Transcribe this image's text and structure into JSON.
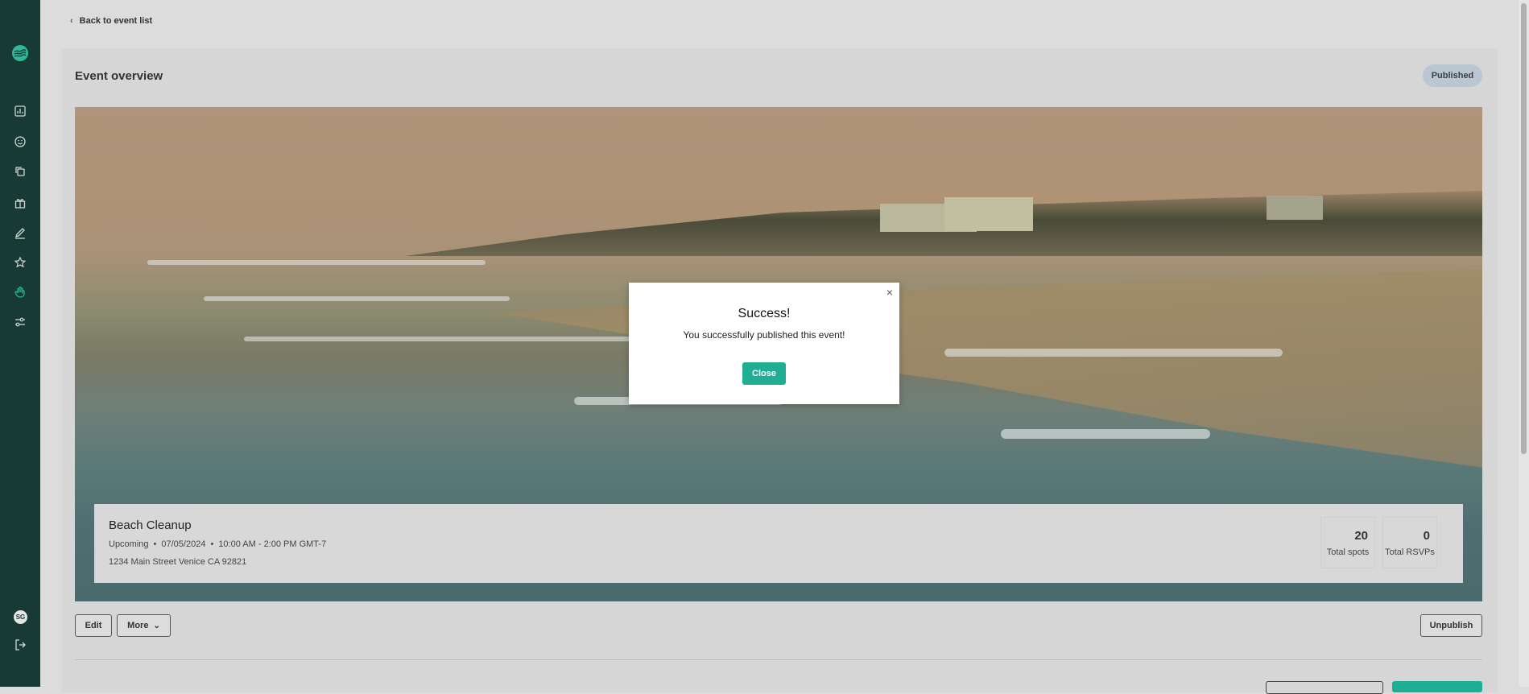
{
  "sidebar": {
    "icons": [
      "logo-icon",
      "dashboard-icon",
      "smile-icon",
      "copy-icon",
      "gift-icon",
      "pencil-icon",
      "star-icon",
      "hand-icon",
      "sliders-icon"
    ],
    "avatar_initials": "SG",
    "logout_icon": "logout-icon"
  },
  "nav": {
    "back_label": "Back to event list"
  },
  "page": {
    "title": "Event overview",
    "status_badge": "Published"
  },
  "event": {
    "name": "Beach Cleanup",
    "status": "Upcoming",
    "date": "07/05/2024",
    "time": "10:00 AM - 2:00 PM GMT-7",
    "address": "1234 Main Street Venice CA 92821",
    "stats": [
      {
        "value": "20",
        "label": "Total spots"
      },
      {
        "value": "0",
        "label": "Total RSVPs"
      }
    ]
  },
  "actions": {
    "edit_label": "Edit",
    "more_label": "More",
    "unpublish_label": "Unpublish"
  },
  "modal": {
    "title": "Success!",
    "message": "You successfully published this event!",
    "close_label": "Close",
    "close_icon": "×"
  },
  "colors": {
    "sidebar": "#173b34",
    "accent": "#1fae94",
    "badge": "#bac6d2"
  }
}
